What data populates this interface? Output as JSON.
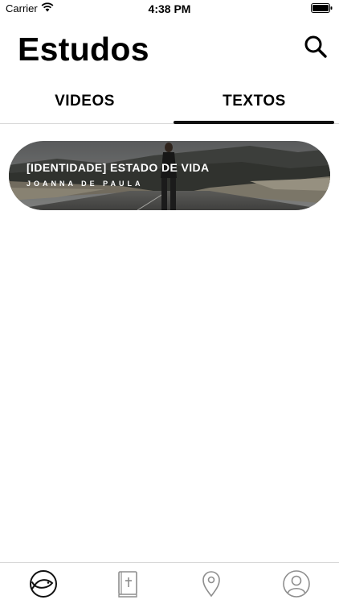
{
  "status_bar": {
    "carrier": "Carrier",
    "time": "4:38 PM",
    "icons": [
      "wifi-icon",
      "battery-icon"
    ]
  },
  "header": {
    "title": "Estudos",
    "search_icon": "search-icon"
  },
  "tabs": [
    {
      "label": "VIDEOS",
      "selected": false
    },
    {
      "label": "TEXTOS",
      "selected": true
    }
  ],
  "studies": [
    {
      "title": "[IDENTIDADE] ESTADO DE VIDA",
      "author": "JOANNA DE PAULA"
    }
  ],
  "tab_bar": {
    "items": [
      {
        "icon": "fish-icon",
        "selected": true
      },
      {
        "icon": "bible-icon",
        "selected": false
      },
      {
        "icon": "location-pin-icon",
        "selected": false
      },
      {
        "icon": "profile-icon",
        "selected": false
      }
    ]
  },
  "colors": {
    "text": "#000000",
    "divider": "#d8d8d8",
    "indicator": "#111111",
    "icon_inactive": "#8e8e8e"
  }
}
